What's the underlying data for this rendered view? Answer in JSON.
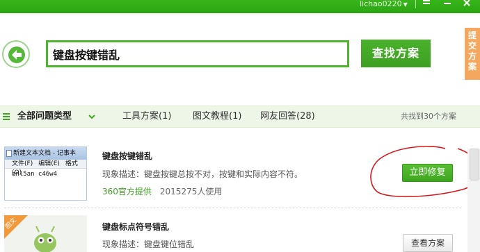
{
  "topbar": {
    "username": "lichao0220",
    "icons": [
      "chevron-down-icon",
      "menu-icon",
      "minimize-icon",
      "close-icon"
    ]
  },
  "search": {
    "query": "键盘按键错乱",
    "button_label": "查找方案"
  },
  "side_tab": {
    "label": "提交方案"
  },
  "categories": {
    "all_label": "全部问题类型",
    "tabs": [
      {
        "label": "工具方案(1)"
      },
      {
        "label": "图文教程(1)"
      },
      {
        "label": "网友回答(28)"
      }
    ],
    "found_text": "共找到30个方案"
  },
  "results": [
    {
      "title": "键盘按键错乱",
      "description": "现象描述：键盘按键总按不对，按键和实际内容不符。",
      "source": "360官方提供",
      "users": "2015275人使用",
      "button_label": "立即修复",
      "thumbnail": {
        "window_title": "新建文本文档 - 记事本",
        "menu_items": [
          "文件(F)",
          "编辑(E)",
          "格式(O)"
        ],
        "content": "anl5an c46w4"
      }
    },
    {
      "title": "键盘标点符号错乱",
      "description": "现象描述：键盘键位错乱",
      "badge": "图文",
      "button_label": "查看方案"
    }
  ],
  "colors": {
    "brand_green": "#3ea51f",
    "accent_orange": "#f4a75f",
    "annotation_red": "#d4171a"
  }
}
